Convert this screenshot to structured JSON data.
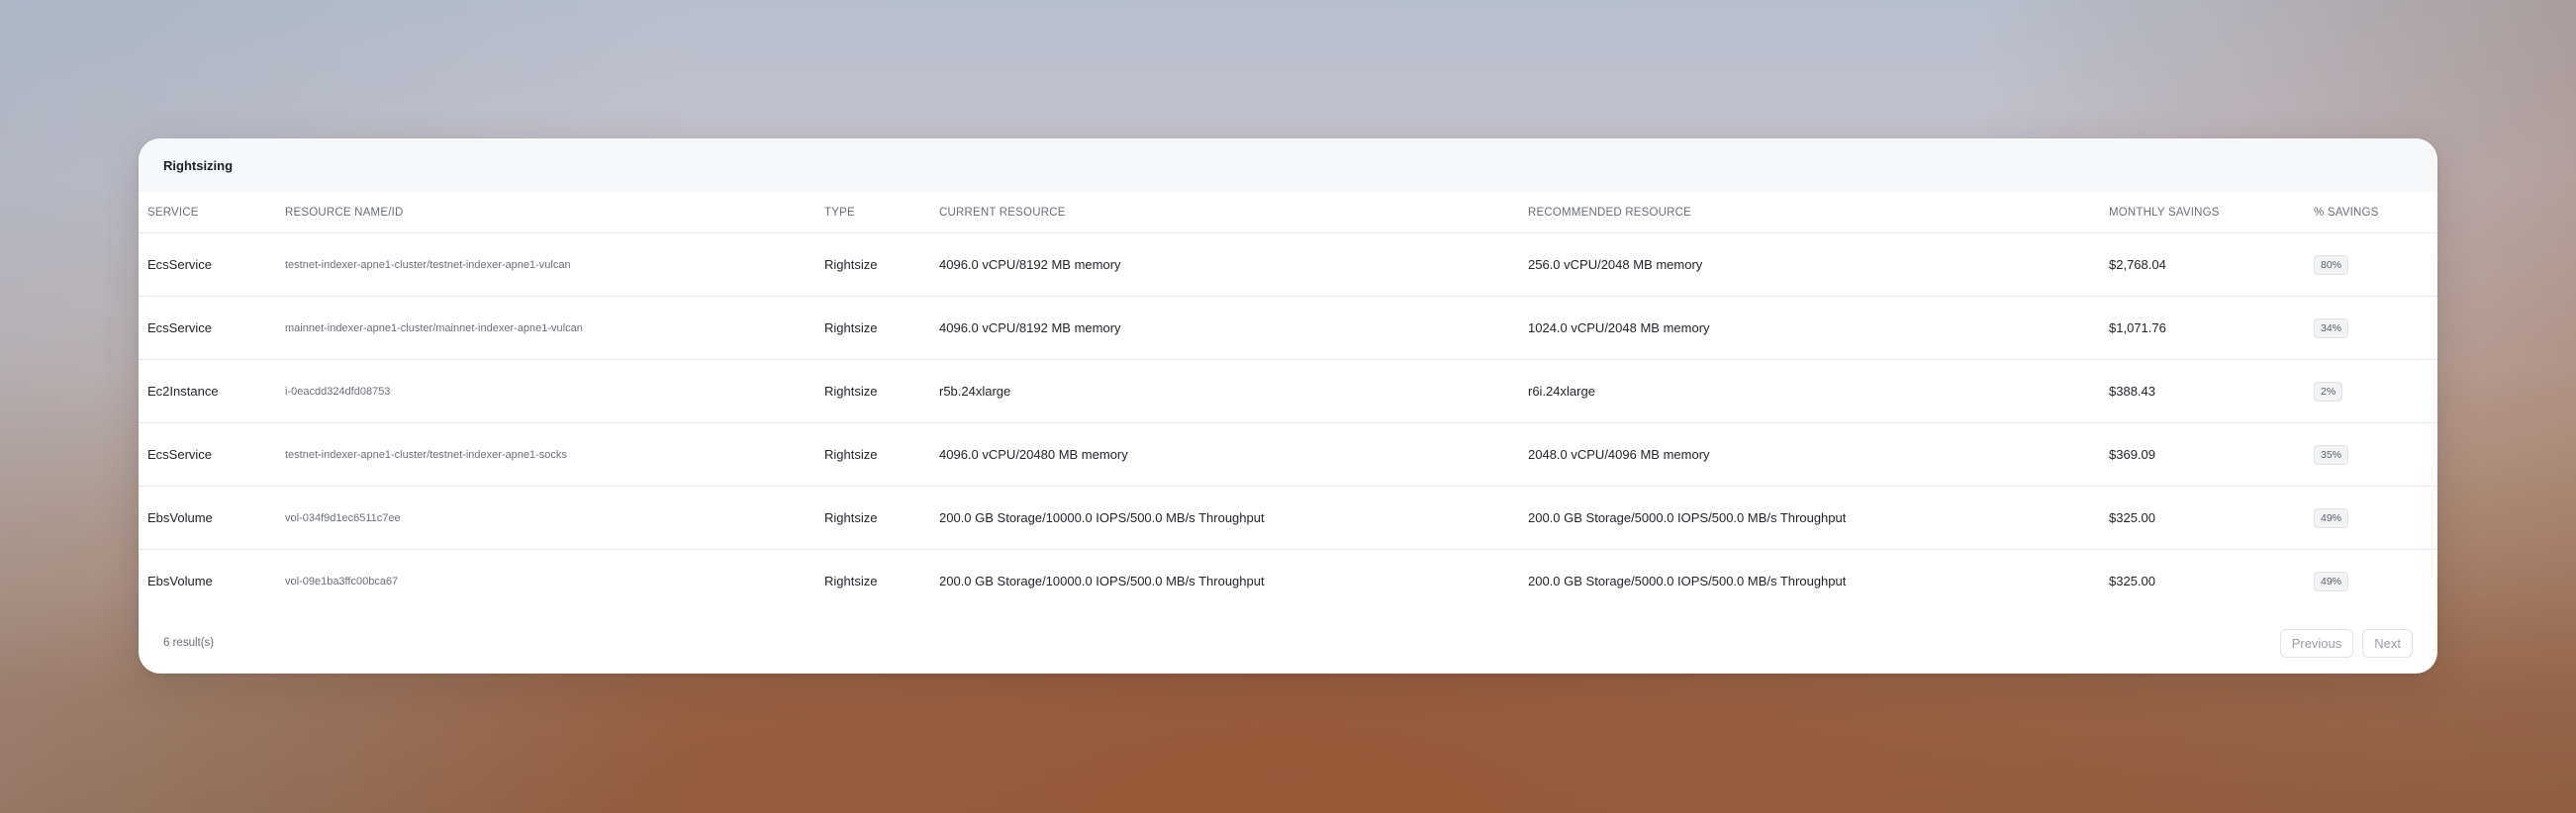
{
  "card": {
    "title": "Rightsizing"
  },
  "table": {
    "columns": [
      "SERVICE",
      "RESOURCE NAME/ID",
      "TYPE",
      "CURRENT RESOURCE",
      "RECOMMENDED RESOURCE",
      "MONTHLY SAVINGS",
      "% SAVINGS"
    ],
    "rows": [
      {
        "service": "EcsService",
        "resource": "testnet-indexer-apne1-cluster/testnet-indexer-apne1-vulcan",
        "type": "Rightsize",
        "current": "4096.0 vCPU/8192 MB memory",
        "recommended": "256.0 vCPU/2048 MB memory",
        "monthly_savings": "$2,768.04",
        "pct_savings": "80%"
      },
      {
        "service": "EcsService",
        "resource": "mainnet-indexer-apne1-cluster/mainnet-indexer-apne1-vulcan",
        "type": "Rightsize",
        "current": "4096.0 vCPU/8192 MB memory",
        "recommended": "1024.0 vCPU/2048 MB memory",
        "monthly_savings": "$1,071.76",
        "pct_savings": "34%"
      },
      {
        "service": "Ec2Instance",
        "resource": "i-0eacdd324dfd08753",
        "type": "Rightsize",
        "current": "r5b.24xlarge",
        "recommended": "r6i.24xlarge",
        "monthly_savings": "$388.43",
        "pct_savings": "2%"
      },
      {
        "service": "EcsService",
        "resource": "testnet-indexer-apne1-cluster/testnet-indexer-apne1-socks",
        "type": "Rightsize",
        "current": "4096.0 vCPU/20480 MB memory",
        "recommended": "2048.0 vCPU/4096 MB memory",
        "monthly_savings": "$369.09",
        "pct_savings": "35%"
      },
      {
        "service": "EbsVolume",
        "resource": "vol-034f9d1ec6511c7ee",
        "type": "Rightsize",
        "current": "200.0 GB Storage/10000.0 IOPS/500.0 MB/s Throughput",
        "recommended": "200.0 GB Storage/5000.0 IOPS/500.0 MB/s Throughput",
        "monthly_savings": "$325.00",
        "pct_savings": "49%"
      },
      {
        "service": "EbsVolume",
        "resource": "vol-09e1ba3ffc00bca67",
        "type": "Rightsize",
        "current": "200.0 GB Storage/10000.0 IOPS/500.0 MB/s Throughput",
        "recommended": "200.0 GB Storage/5000.0 IOPS/500.0 MB/s Throughput",
        "monthly_savings": "$325.00",
        "pct_savings": "49%"
      }
    ]
  },
  "footer": {
    "result_count": "6 result(s)",
    "previous_label": "Previous",
    "next_label": "Next"
  }
}
